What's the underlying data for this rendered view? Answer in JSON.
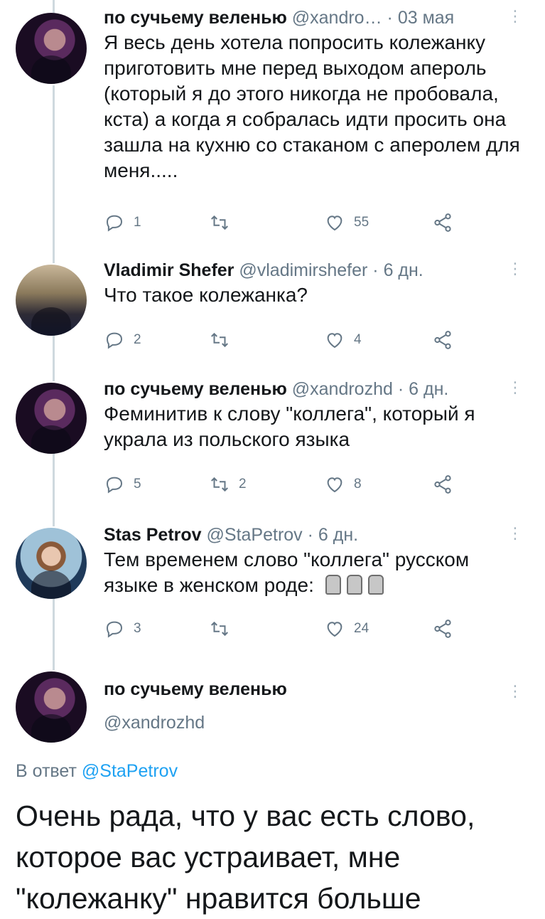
{
  "tweets": [
    {
      "name": "по сучьему веленью",
      "handle": "@xandro…",
      "time": "· 03 мая",
      "text": "Я весь день хотела попросить колежанку приготовить мне перед выходом апероль (который я до этого никогда не пробовала, кста) а когда я собралась идти просить она зашла на кухню со стаканом с аперолем для меня.....",
      "replies": "1",
      "retweets": "",
      "likes": "55"
    },
    {
      "name": "Vladimir Shefer",
      "handle": "@vladimirshefer",
      "time": "· 6 дн.",
      "text": "Что такое колежанка?",
      "replies": "2",
      "retweets": "",
      "likes": "4"
    },
    {
      "name": "по сучьему веленью",
      "handle": "@xandrozhd",
      "time": "· 6 дн.",
      "text": "Феминитив к слову \"коллега\", который я украла из польского языка",
      "replies": "5",
      "retweets": "2",
      "likes": "8"
    },
    {
      "name": "Stas Petrov",
      "handle": "@StaPetrov",
      "time": "· 6 дн.",
      "text": "Тем временем слово \"коллега\" русском языке в женском роде:",
      "replies": "3",
      "retweets": "",
      "likes": "24"
    }
  ],
  "main_tweet": {
    "name": "по сучьему веленью",
    "handle": "@xandrozhd",
    "reply_prefix": "В ответ",
    "reply_to": "@StaPetrov",
    "text": "Очень рада, что у вас есть слово, которое вас устраивает, мне \"колежанку\" нравится больше"
  },
  "icons": {
    "reply": "reply-icon",
    "retweet": "retweet-icon",
    "like": "heart-icon",
    "share": "share-icon",
    "more": "more-options-icon",
    "emoji": "moai-emoji"
  },
  "colors": {
    "text": "#14171a",
    "secondary": "#657786",
    "link": "#1da1f2",
    "thread_line": "#cfd9de"
  }
}
